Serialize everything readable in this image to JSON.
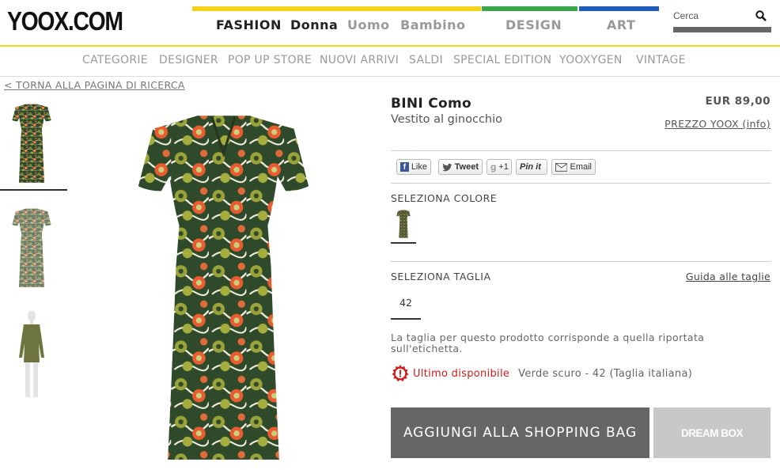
{
  "header": {
    "logo": "YOOX.COM",
    "nav": {
      "fashion": "FASHION",
      "donna": "Donna",
      "uomo": "Uomo",
      "bambino": "Bambino",
      "design": "DESIGN",
      "art": "ART"
    },
    "search_placeholder": "Cerca",
    "colors": {
      "fashion_bar": "#f2d51b",
      "design_bar": "#3aa64a",
      "art_bar": "#1f5bb8"
    }
  },
  "category_nav": [
    "CATEGORIE",
    "DESIGNER",
    "POP UP STORE",
    "NUOVI ARRIVI",
    "SALDI",
    "SPECIAL EDITION",
    "YOOXYGEN",
    "VINTAGE"
  ],
  "back_link": "< TORNA ALLA PAGINA DI RICERCA",
  "product": {
    "brand": "BINI Como",
    "description": "Vestito al ginocchio",
    "price": "EUR 89,00",
    "price_link": "PREZZO YOOX (info)"
  },
  "social": {
    "like": "Like",
    "tweet": "Tweet",
    "plus": "+1",
    "pin": "Pin it",
    "email": "Email"
  },
  "color_section": {
    "label": "SELEZIONA COLORE"
  },
  "size_section": {
    "label": "SELEZIONA TAGLIA",
    "guide_link": "Guida alle taglie",
    "sizes": [
      "42"
    ],
    "note": "La taglia per questo prodotto corrisponde a quella riportata sull'etichetta."
  },
  "availability": {
    "status": "Ultimo disponibile",
    "detail": "Verde scuro - 42 (Taglia italiana)"
  },
  "actions": {
    "add_to_bag": "AGGIUNGI ALLA SHOPPING BAG",
    "dream_box": "DREAM BOX"
  }
}
